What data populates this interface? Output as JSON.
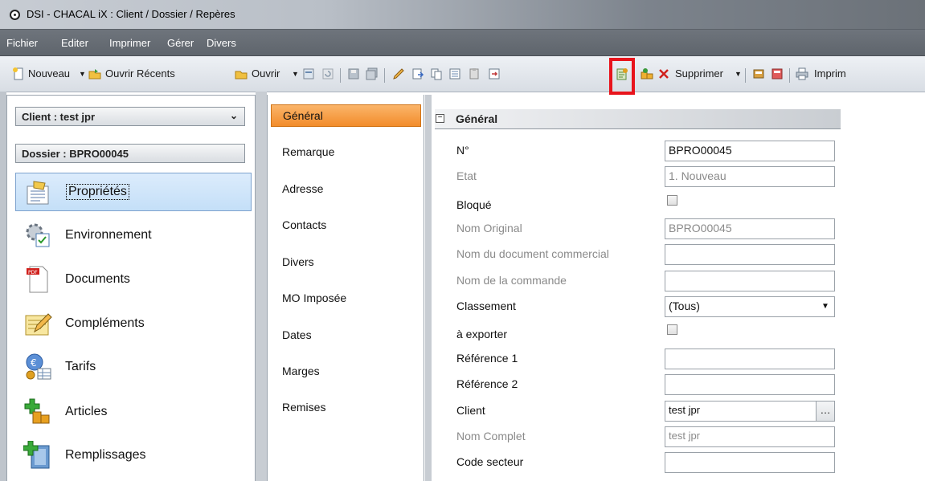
{
  "window": {
    "title": "DSI - CHACAL iX : Client / Dossier / Repères"
  },
  "menu": [
    "Fichier",
    "Editer",
    "Imprimer",
    "Gérer",
    "Divers"
  ],
  "toolbar": {
    "nouveau": "Nouveau",
    "ouvrir_recents": "Ouvrir Récents",
    "ouvrir": "Ouvrir",
    "supprimer": "Supprimer",
    "imprimer": "Imprim"
  },
  "nav": {
    "client_header": "Client : test jpr",
    "dossier_header": "Dossier : BPRO00045",
    "items": [
      {
        "label": "Propriétés",
        "icon": "properties-icon",
        "selected": true
      },
      {
        "label": "Environnement",
        "icon": "gear-checklist-icon"
      },
      {
        "label": "Documents",
        "icon": "pdf-document-icon"
      },
      {
        "label": "Compléments",
        "icon": "pencil-note-icon"
      },
      {
        "label": "Tarifs",
        "icon": "euro-coins-icon"
      },
      {
        "label": "Articles",
        "icon": "add-articles-icon"
      },
      {
        "label": "Remplissages",
        "icon": "add-glazing-icon"
      }
    ]
  },
  "tabs": [
    "Général",
    "Remarque",
    "Adresse",
    "Contacts",
    "Divers",
    "MO Imposée",
    "Dates",
    "Marges",
    "Remises"
  ],
  "active_tab": "Général",
  "section": {
    "title": "Général"
  },
  "properties": [
    {
      "name": "N°",
      "value": "BPRO00045",
      "type": "text"
    },
    {
      "name": "Etat",
      "value": "1. Nouveau",
      "type": "text",
      "disabled": true
    },
    {
      "name": "Bloqué",
      "value": false,
      "type": "checkbox"
    },
    {
      "name": "Nom Original",
      "value": "BPRO00045",
      "type": "text",
      "disabled": true
    },
    {
      "name": "Nom du document commercial",
      "value": "",
      "type": "text",
      "disabled_label": true
    },
    {
      "name": "Nom de la commande",
      "value": "",
      "type": "text",
      "disabled_label": true
    },
    {
      "name": "Classement",
      "value": "(Tous)",
      "type": "select"
    },
    {
      "name": "à exporter",
      "value": false,
      "type": "checkbox"
    },
    {
      "name": "Référence 1",
      "value": "",
      "type": "text"
    },
    {
      "name": "Référence 2",
      "value": "",
      "type": "text"
    },
    {
      "name": "Client",
      "value": "test jpr",
      "type": "picker"
    },
    {
      "name": "Nom Complet",
      "value": "test jpr",
      "type": "text",
      "disabled": true
    },
    {
      "name": "Code secteur",
      "value": "",
      "type": "text"
    }
  ],
  "colors": {
    "highlight": "#e8141c",
    "active_tab": "#f28c2b",
    "selected_nav": "#c4dff8"
  }
}
